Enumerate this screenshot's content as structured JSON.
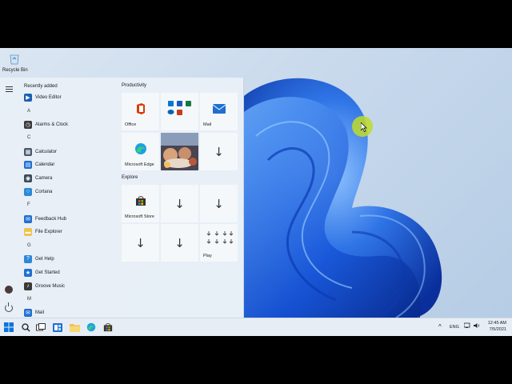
{
  "desktop": {
    "recycle_bin_label": "Recycle Bin"
  },
  "start_menu": {
    "apps": [
      {
        "type": "head",
        "text": "Recently added"
      },
      {
        "type": "app",
        "name": "Video Editor",
        "icon": "video-editor-icon",
        "color": "#1b5fb1"
      },
      {
        "type": "letter",
        "text": "A"
      },
      {
        "type": "app",
        "name": "Alarms & Clock",
        "icon": "clock-icon",
        "color": "#3a3a3a"
      },
      {
        "type": "letter",
        "text": "C"
      },
      {
        "type": "app",
        "name": "Calculator",
        "icon": "calculator-icon",
        "color": "#4a5a6a"
      },
      {
        "type": "app",
        "name": "Calendar",
        "icon": "calendar-icon",
        "color": "#1f6fd1"
      },
      {
        "type": "app",
        "name": "Camera",
        "icon": "camera-icon",
        "color": "#3c4b5b"
      },
      {
        "type": "app",
        "name": "Cortana",
        "icon": "cortana-icon",
        "color": "#2b88d8"
      },
      {
        "type": "letter",
        "text": "F"
      },
      {
        "type": "app",
        "name": "Feedback Hub",
        "icon": "feedback-hub-icon",
        "color": "#1f6fd1"
      },
      {
        "type": "app",
        "name": "File Explorer",
        "icon": "folder-icon",
        "color": "#f1c14e"
      },
      {
        "type": "letter",
        "text": "G"
      },
      {
        "type": "app",
        "name": "Get Help",
        "icon": "help-icon",
        "color": "#2b88d8"
      },
      {
        "type": "app",
        "name": "Get Started",
        "icon": "get-started-icon",
        "color": "#1f6fd1"
      },
      {
        "type": "app",
        "name": "Groove Music",
        "icon": "music-icon",
        "color": "#3a3a3a"
      },
      {
        "type": "letter",
        "text": "M"
      },
      {
        "type": "app",
        "name": "Mail",
        "icon": "mail-icon",
        "color": "#1f6fd1"
      }
    ],
    "productivity_title": "Productivity",
    "explore_title": "Explore",
    "tiles": {
      "office": "Office",
      "mail": "Mail",
      "edge": "Microsoft Edge",
      "store": "Microsoft Store",
      "play": "Play"
    }
  },
  "taskbar": {
    "tray_lang": "ENG",
    "time": "12:45 AM",
    "date": "7/5/2021"
  }
}
